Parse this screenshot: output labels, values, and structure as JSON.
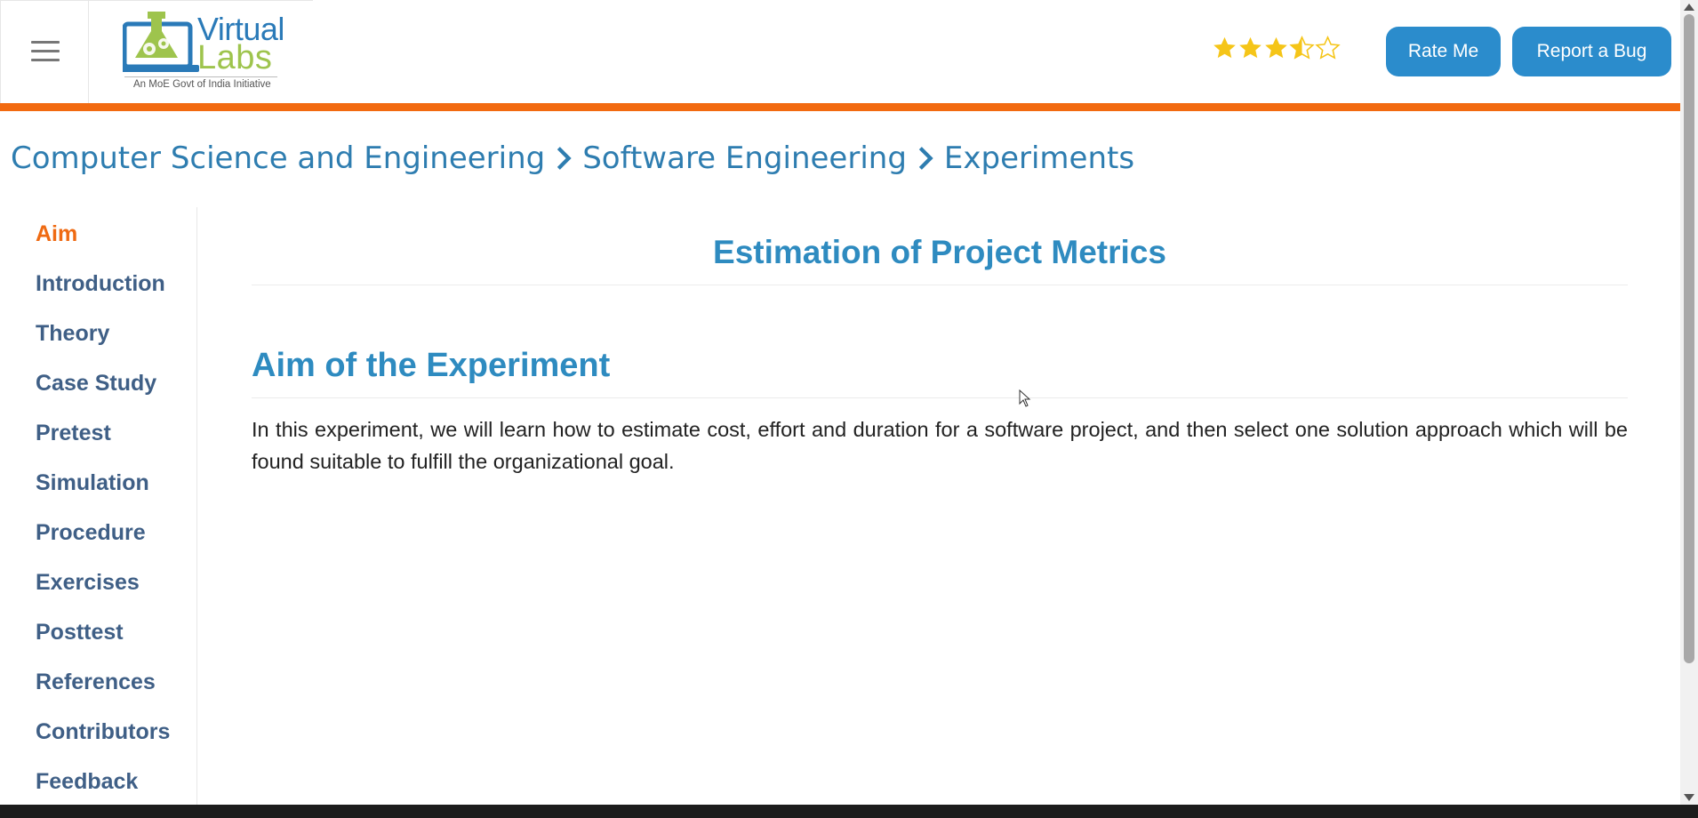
{
  "header": {
    "logo": {
      "word1": "Virtual",
      "word2": "Labs",
      "tagline": "An MoE Govt of India Initiative"
    },
    "rating": {
      "value": 3.5,
      "max": 5,
      "color": "#f5c518"
    },
    "rate_button_label": "Rate Me",
    "bug_button_label": "Report a Bug"
  },
  "breadcrumb": [
    "Computer Science and Engineering",
    "Software Engineering",
    "Experiments"
  ],
  "sidebar": {
    "items": [
      {
        "label": "Aim",
        "active": true
      },
      {
        "label": "Introduction"
      },
      {
        "label": "Theory"
      },
      {
        "label": "Case Study"
      },
      {
        "label": "Pretest"
      },
      {
        "label": "Simulation"
      },
      {
        "label": "Procedure"
      },
      {
        "label": "Exercises"
      },
      {
        "label": "Posttest"
      },
      {
        "label": "References"
      },
      {
        "label": "Contributors"
      },
      {
        "label": "Feedback"
      }
    ]
  },
  "main": {
    "title": "Estimation of Project Metrics",
    "section_title": "Aim of the Experiment",
    "paragraph": "In this experiment, we will learn how to estimate cost, effort and duration for a software project, and then select one solution approach which will be found suitable to fulfill the organizational goal."
  },
  "colors": {
    "accent_orange": "#f26a10",
    "brand_blue": "#2b8ccc",
    "heading_blue": "#2e8bc0",
    "sidebar_text": "#3f5f86"
  }
}
